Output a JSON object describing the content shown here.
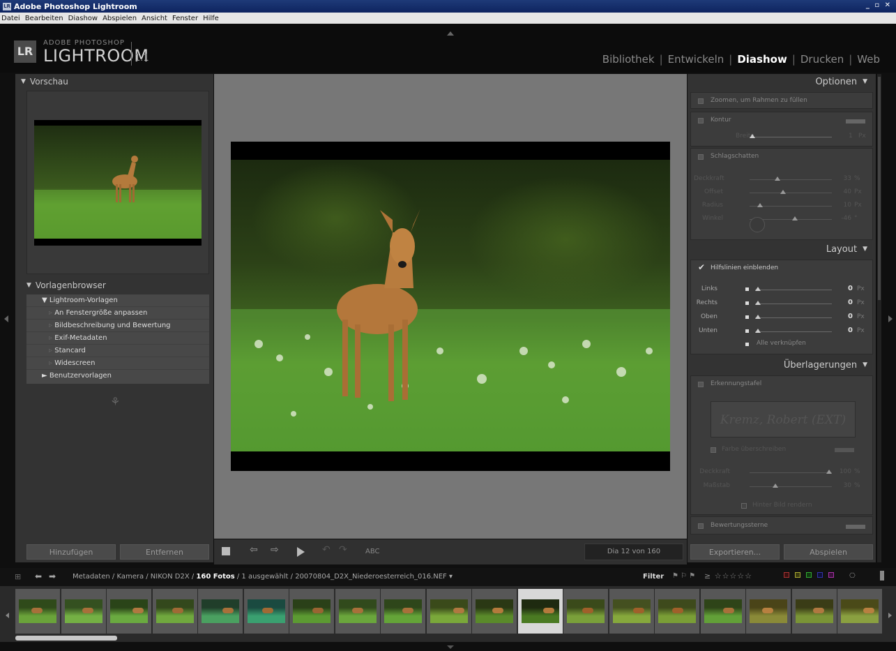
{
  "window": {
    "title": "Adobe Photoshop Lightroom",
    "icon_text": "LR",
    "controls": "_ ▫ ✕"
  },
  "menu": [
    "Datei",
    "Bearbeiten",
    "Diashow",
    "Abspielen",
    "Ansicht",
    "Fenster",
    "Hilfe"
  ],
  "logo": {
    "box": "LR",
    "small": "ADOBE PHOTOSHOP",
    "big": "LIGHTROOM",
    "version": "1.1"
  },
  "modules": [
    {
      "label": "Bibliothek",
      "active": false
    },
    {
      "label": "Entwickeln",
      "active": false
    },
    {
      "label": "Diashow",
      "active": true
    },
    {
      "label": "Drucken",
      "active": false
    },
    {
      "label": "Web",
      "active": false
    }
  ],
  "left": {
    "preview_title": "Vorschau",
    "templates_title": "Vorlagenbrowser",
    "tree": [
      {
        "label": "Lightroom-Vorlagen",
        "marker": "▼"
      },
      {
        "label": "An Fenstergröße anpassen",
        "marker": "▹"
      },
      {
        "label": "Bildbeschreibung und Bewertung",
        "marker": "▹"
      },
      {
        "label": "Exif-Metadaten",
        "marker": "▹"
      },
      {
        "label": "Stancard",
        "marker": "▹"
      },
      {
        "label": "Widescreen",
        "marker": "▹"
      },
      {
        "label": "Benutzervorlagen",
        "marker": "►"
      }
    ],
    "add_button": "Hinzufügen",
    "remove_button": "Entfernen"
  },
  "toolbar": {
    "text_tool": "ABC",
    "counter": "Dia 12 von 160"
  },
  "right": {
    "options_title": "Optionen",
    "zoom_label": "Zoomen, um Rahmen zu füllen",
    "kontur_label": "Kontur",
    "breite_label": "Breite",
    "breite_value": "1",
    "shadow_label": "Schlagschatten",
    "shadow_rows": [
      {
        "label": "Deckkraft",
        "value": "33",
        "unit": "%",
        "level": 0.33
      },
      {
        "label": "Offset",
        "value": "40",
        "unit": "Px",
        "level": 0.4
      },
      {
        "label": "Radius",
        "value": "10",
        "unit": "Px",
        "level": 0.1
      },
      {
        "label": "Winkel",
        "value": "-46",
        "unit": "°",
        "level": 0.55
      }
    ],
    "layout_title": "Layout",
    "guides_label": "Hilfslinien einblenden",
    "layout_rows": [
      {
        "label": "Links",
        "value": "0",
        "unit": "Px"
      },
      {
        "label": "Rechts",
        "value": "0",
        "unit": "Px"
      },
      {
        "label": "Oben",
        "value": "0",
        "unit": "Px"
      },
      {
        "label": "Unten",
        "value": "0",
        "unit": "Px"
      }
    ],
    "link_all": "Alle verknüpfen",
    "overlays_title": "Überlagerungen",
    "identity_label": "Erkennungstafel",
    "identity_text": "Kremz, Robert (EXT)",
    "override_color": "Farbe überschreiben",
    "overlay_rows": [
      {
        "label": "Deckkraft",
        "value": "100",
        "unit": "%",
        "level": 1.0
      },
      {
        "label": "Maßstab",
        "value": "30",
        "unit": "%",
        "level": 0.3
      }
    ],
    "render_behind": "Hinter Bild rendern",
    "rating_label": "Bewertungssterne",
    "export_button": "Exportieren...",
    "play_button": "Abspielen"
  },
  "filmbar": {
    "path": "Metadaten / Kamera / NIKON D2X / ",
    "count": "160 Fotos",
    "rest": " / 1 ausgewählt / 20070804_D2X_Niederoesterreich_016.NEF",
    "filter": "Filter",
    "stars": "≥ ☆☆☆☆☆"
  },
  "filmstrip": {
    "count": 19,
    "selected_index": 11
  }
}
